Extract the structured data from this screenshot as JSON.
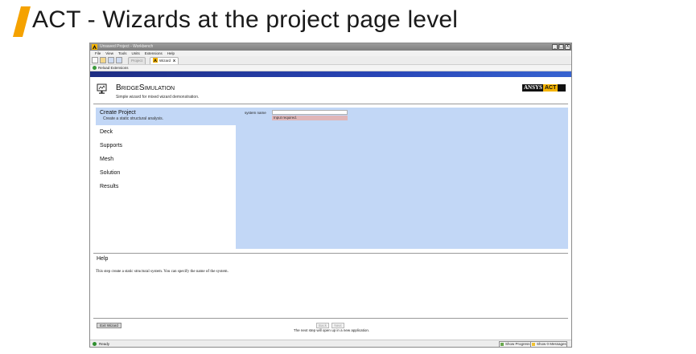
{
  "slide": {
    "title": "ACT - Wizards at the project page level",
    "accent_color": "#f5a200"
  },
  "window": {
    "title": "Unsaved Project - Workbench",
    "controls": [
      "_",
      "□",
      "X"
    ],
    "menu": [
      "File",
      "View",
      "Tools",
      "Units",
      "Extensions",
      "Help"
    ],
    "tabs": [
      {
        "label": "Project",
        "icon": "project-icon",
        "active": false
      },
      {
        "label": "Wizard",
        "icon": "workbench-icon",
        "active": true,
        "close": "X"
      }
    ],
    "extension_bar_label": "Reload Extensions",
    "status": "Ready",
    "show_progress": "Show Progress",
    "show_messages": "Show 0 Messages",
    "bar_color": "#2845b6"
  },
  "wizard": {
    "title_lead1": "B",
    "title_rest1": "RIDGE",
    "title_lead2": "S",
    "title_rest2": "IMULATION",
    "subtitle": "Simple wizard for mixed wizard demonstration.",
    "logo_text": "ANSYS",
    "logo_act": "ACT",
    "panel_color": "#c2d7f6",
    "steps": [
      {
        "label": "Create Project",
        "description": "Create a static structural analysis.",
        "active": true
      },
      {
        "label": "Deck"
      },
      {
        "label": "Supports"
      },
      {
        "label": "Mesh"
      },
      {
        "label": "Solution"
      },
      {
        "label": "Results"
      }
    ],
    "field": {
      "label": "system name",
      "value": "",
      "error": "Input required."
    },
    "help": {
      "title": "Help",
      "text": "This step create a static structural system. You can specify the name of the system."
    },
    "buttons": {
      "exit": "Exit Wizard",
      "back": "Back",
      "next": "Next"
    },
    "next_note": "The next step will open up in a new application."
  }
}
